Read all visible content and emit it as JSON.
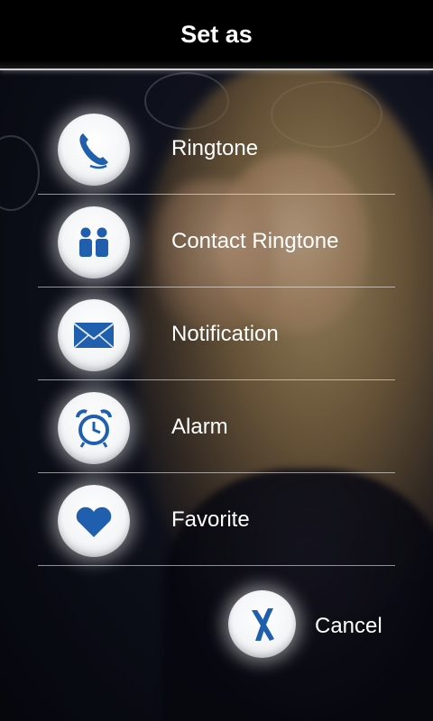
{
  "header": {
    "title": "Set as"
  },
  "options": [
    {
      "label": "Ringtone",
      "icon": "phone-icon"
    },
    {
      "label": "Contact Ringtone",
      "icon": "contacts-icon"
    },
    {
      "label": "Notification",
      "icon": "envelope-icon"
    },
    {
      "label": "Alarm",
      "icon": "alarm-clock-icon"
    },
    {
      "label": "Favorite",
      "icon": "heart-icon"
    }
  ],
  "cancel": {
    "label": "Cancel",
    "icon": "x-icon"
  },
  "colors": {
    "icon_blue": "#1f5fae",
    "header_bg": "#000000",
    "text": "#ffffff"
  }
}
